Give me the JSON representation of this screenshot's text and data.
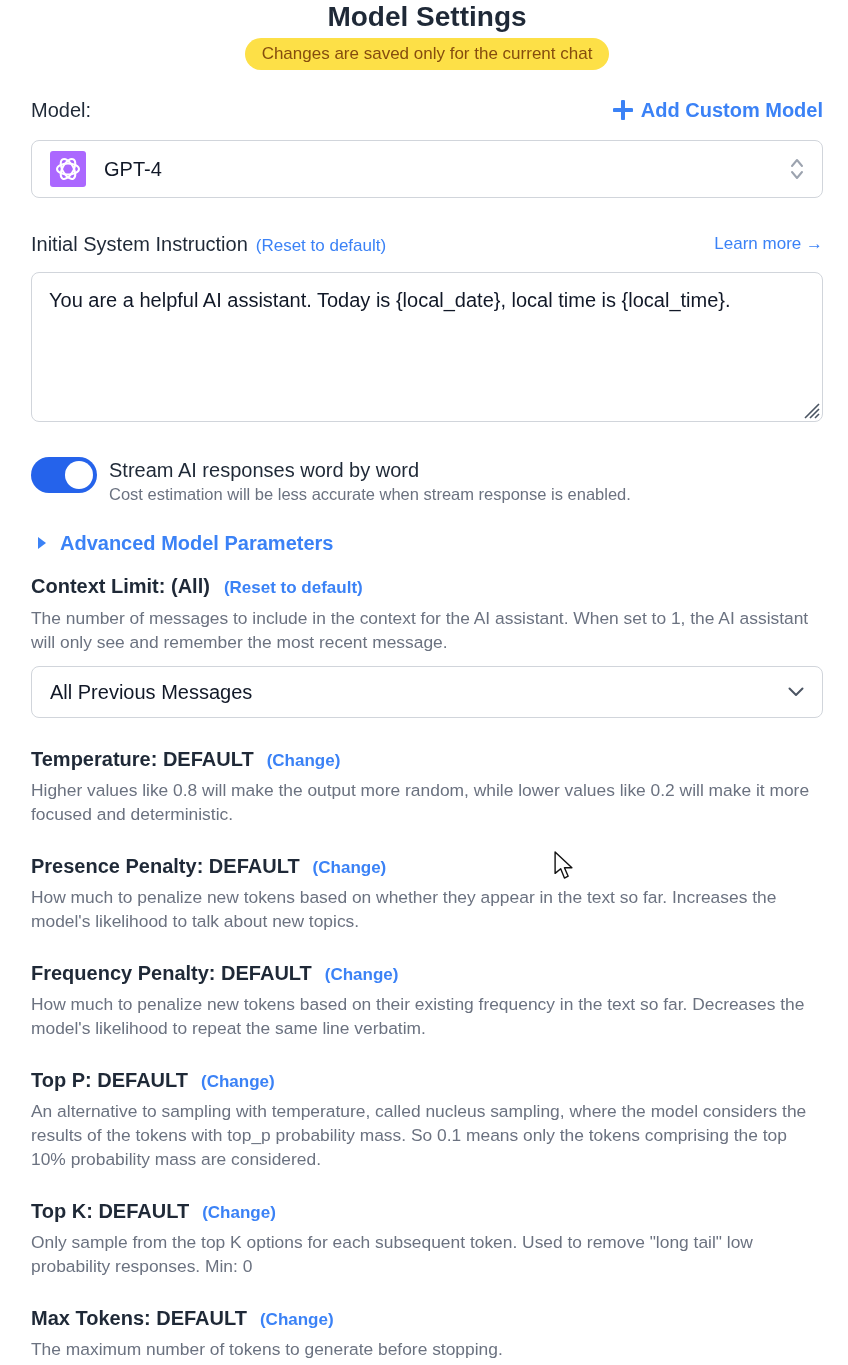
{
  "title": "Model Settings",
  "notice": "Changes are saved only for the current chat",
  "model": {
    "label": "Model:",
    "add_button": "Add Custom Model",
    "selected_model": "GPT-4"
  },
  "system_instruction": {
    "label": "Initial System Instruction",
    "reset_link": "(Reset to default)",
    "learn_more": "Learn more →",
    "value": "You are a helpful AI assistant. Today is {local_date}, local time is {local_time}."
  },
  "stream": {
    "on": true,
    "label": "Stream AI responses word by word",
    "hint": "Cost estimation will be less accurate when stream response is enabled."
  },
  "advanced": {
    "label": "Advanced Model Parameters",
    "expanded": false
  },
  "context_limit": {
    "label": "Context Limit: (All)",
    "reset_link": "(Reset to default)",
    "description": "The number of messages to include in the context for the AI assistant. When set to 1, the AI assistant will only see and remember the most recent message.",
    "value": "All Previous Messages"
  },
  "parameters": [
    {
      "label": "Temperature: DEFAULT",
      "link": "(Change)",
      "description": "Higher values like 0.8 will make the output more random, while lower values like 0.2 will make it more focused and deterministic."
    },
    {
      "label": "Presence Penalty: DEFAULT",
      "link": "(Change)",
      "description": "How much to penalize new tokens based on whether they appear in the text so far. Increases the model's likelihood to talk about new topics."
    },
    {
      "label": "Frequency Penalty: DEFAULT",
      "link": "(Change)",
      "description": "How much to penalize new tokens based on their existing frequency in the text so far. Decreases the model's likelihood to repeat the same line verbatim."
    },
    {
      "label": "Top P: DEFAULT",
      "link": "(Change)",
      "description": "An alternative to sampling with temperature, called nucleus sampling, where the model considers the results of the tokens with top_p probability mass. So 0.1 means only the tokens comprising the top 10% probability mass are considered."
    },
    {
      "label": "Top K: DEFAULT",
      "link": "(Change)",
      "description": "Only sample from the top K options for each subsequent token. Used to remove \"long tail\" low probability responses. Min: 0"
    },
    {
      "label": "Max Tokens: DEFAULT",
      "link": "(Change)",
      "description": "The maximum number of tokens to generate before stopping."
    }
  ]
}
